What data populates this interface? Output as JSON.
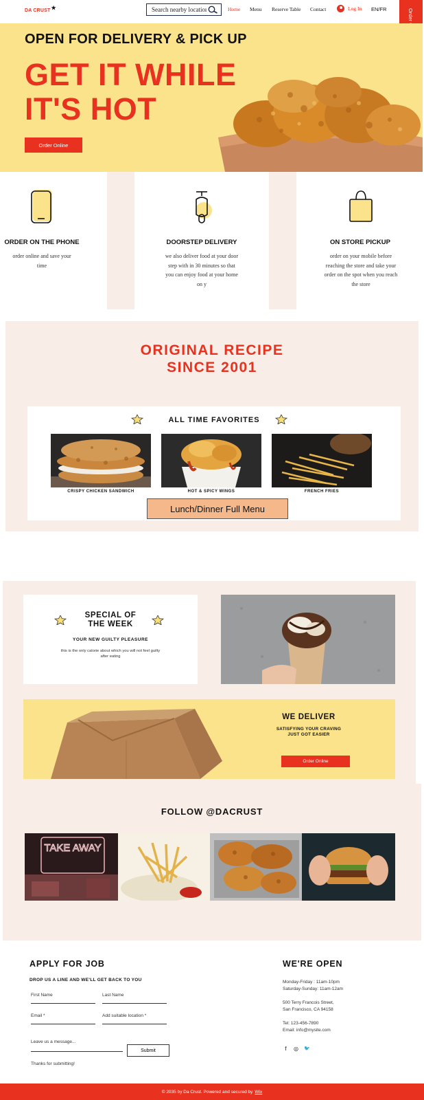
{
  "header": {
    "logo": "DA CRUST",
    "search_placeholder": "Search nearby locations",
    "nav": [
      "Home",
      "Menu",
      "Reserve Table",
      "Contact"
    ],
    "login": "Log In",
    "lang": "EN/FR",
    "side_order": "Order Online"
  },
  "hero": {
    "sub": "OPEN FOR DELIVERY & PICK UP",
    "title_line1": "GET IT WHILE",
    "title_line2": "IT'S HOT",
    "button": "Order Online"
  },
  "features": [
    {
      "title": "ORDER ON THE PHONE",
      "text": "order online and save your time"
    },
    {
      "title": "DOORSTEP DELIVERY",
      "text": "we also deliver food at your door step with in 30 minutes so that you can enjoy food at your home on y"
    },
    {
      "title": "ON STORE PICKUP",
      "text": "order on your mobile before reaching the store and take your order on the spot when you reach the store"
    }
  ],
  "recipe": {
    "title_line1": "ORIGINAL RECIPE",
    "title_line2": "SINCE 2001",
    "favorites_title": "ALL TIME FAVORITES",
    "items": [
      "CRISPY CHICKEN SANDWICH",
      "HOT & SPICY WINGS",
      "FRENCH FRIES"
    ],
    "menu_button": "Lunch/Dinner Full Menu"
  },
  "special": {
    "title_line1": "SPECIAL OF",
    "title_line2": "THE WEEK",
    "subtitle": "YOUR NEW GUILTY PLEASURE",
    "text": "this is the only calorie about which you will not feel guilty after eating"
  },
  "deliver": {
    "title": "WE DELIVER",
    "sub_line1": "SATISFYING YOUR CRAVING",
    "sub_line2": "JUST GOT EASIER",
    "button": "Order Online"
  },
  "follow": {
    "title": "FOLLOW @DACRUST",
    "neon_text": "TAKE AWAY"
  },
  "apply": {
    "title": "APPLY FOR JOB",
    "subtitle": "DROP US A LINE AND WE'LL GET BACK TO YOU",
    "first_name": "First Name",
    "last_name": "Last Name",
    "email": "Email *",
    "location": "Add suitable location *",
    "message": "Leave us a message...",
    "submit": "Submit",
    "thanks": "Thanks for submitting!"
  },
  "open": {
    "title": "WE'RE OPEN",
    "hours1": "Monday-Friday : 11am-10pm",
    "hours2": "Saturday-Sunday: 11am-12am",
    "address1": "500 Terry Francois Street,",
    "address2": "San Francisco, CA 94158",
    "tel": "Tel: 123-456-7890",
    "email": "Email: info@mysite.com",
    "social": [
      "f",
      "◎",
      "🐦"
    ]
  },
  "footer": {
    "text": "© 2035 by Da Crust. Powered and secured by",
    "link": "Wix"
  },
  "colors": {
    "accent": "#e8321f",
    "hero_bg": "#fbe38c",
    "section_bg": "#f8ede7",
    "menu_button": "#f5b88a"
  }
}
